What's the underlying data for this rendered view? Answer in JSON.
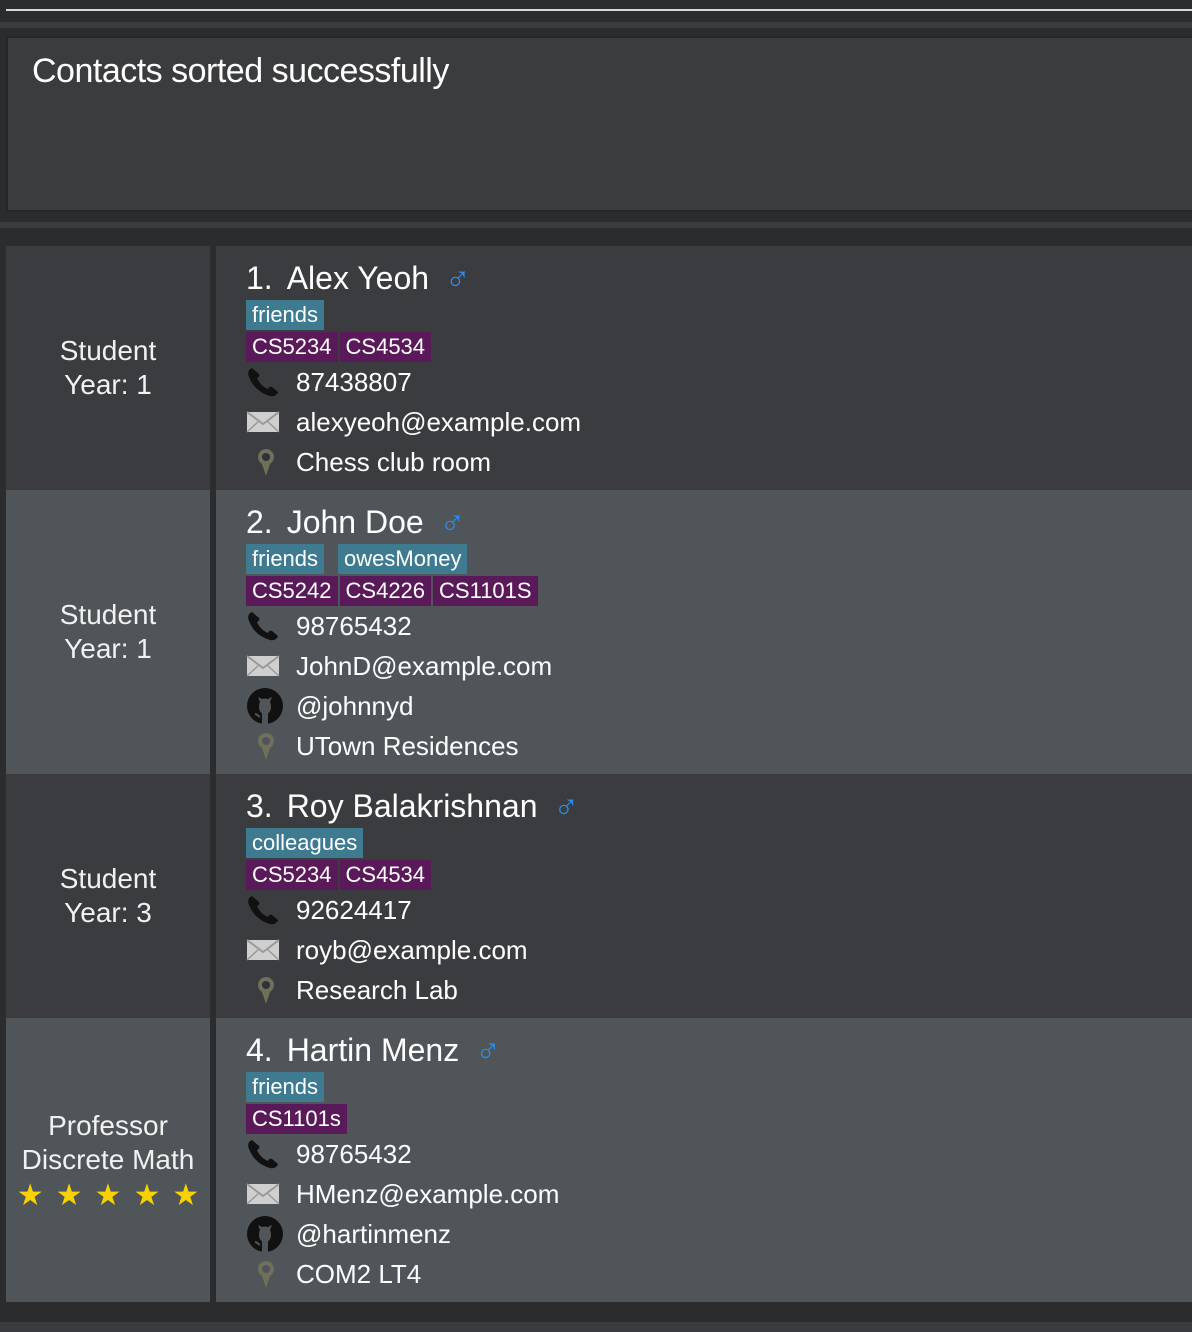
{
  "result": {
    "message": "Contacts sorted successfully"
  },
  "colors": {
    "tag": "#3e7b91",
    "module": "#5a1a5a",
    "gender": "#2f8ce6",
    "star": "#f7d100"
  },
  "contacts": [
    {
      "index": "1.",
      "name": "Alex Yeoh",
      "gender_icon": "male-icon",
      "role_line1": "Student",
      "role_line2": "Year: 1",
      "tags": [
        "friends"
      ],
      "modules": [
        "CS5234",
        "CS4534"
      ],
      "phone": "87438807",
      "email": "alexyeoh@example.com",
      "location": "Chess club room"
    },
    {
      "index": "2.",
      "name": "John Doe",
      "gender_icon": "male-icon",
      "role_line1": "Student",
      "role_line2": "Year: 1",
      "tags": [
        "friends",
        "owesMoney"
      ],
      "modules": [
        "CS5242",
        "CS4226",
        "CS1101S"
      ],
      "phone": "98765432",
      "email": "JohnD@example.com",
      "github": "@johnnyd",
      "location": "UTown Residences"
    },
    {
      "index": "3.",
      "name": "Roy Balakrishnan",
      "gender_icon": "male-icon",
      "role_line1": "Student",
      "role_line2": "Year: 3",
      "tags": [
        "colleagues"
      ],
      "modules": [
        "CS5234",
        "CS4534"
      ],
      "phone": "92624417",
      "email": "royb@example.com",
      "location": "Research Lab"
    },
    {
      "index": "4.",
      "name": "Hartin Menz",
      "gender_icon": "male-icon",
      "role_line1": "Professor",
      "role_line2": "Discrete Math",
      "rating": 5,
      "tags": [
        "friends"
      ],
      "modules": [
        "CS1101s"
      ],
      "phone": "98765432",
      "email": "HMenz@example.com",
      "github": "@hartinmenz",
      "location": "COM2 LT4"
    }
  ]
}
